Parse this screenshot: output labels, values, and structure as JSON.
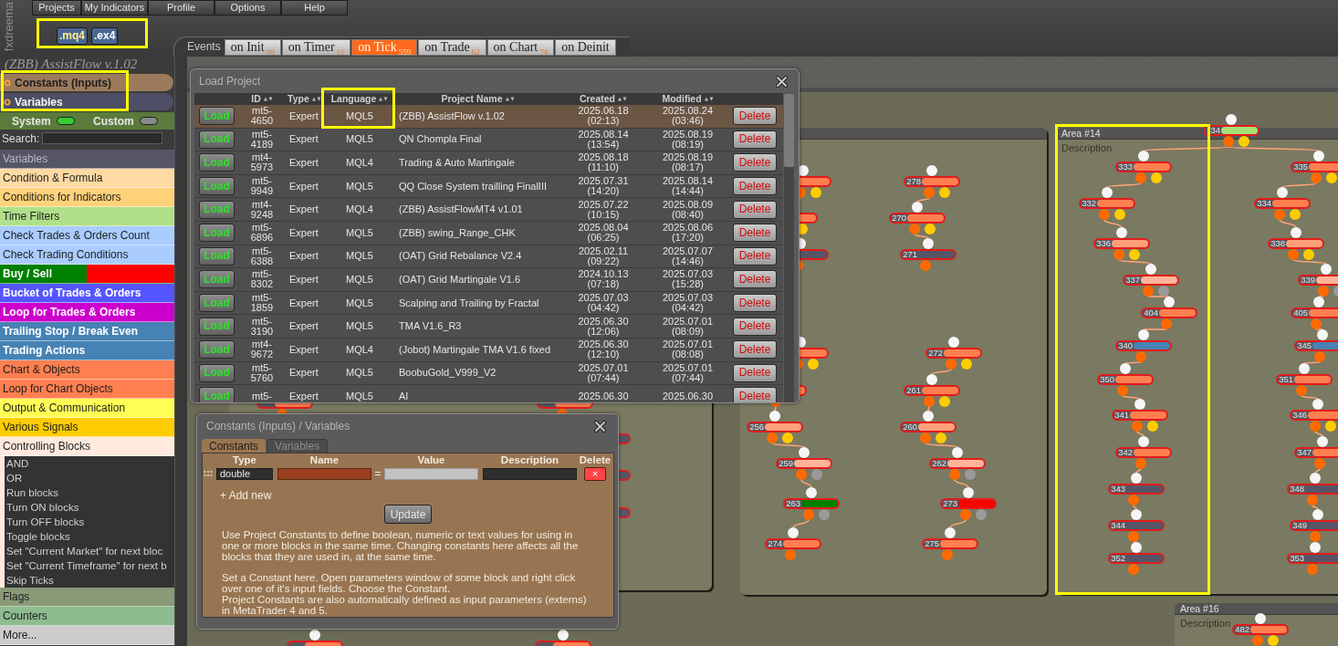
{
  "logo": "fxdreema",
  "menu": [
    "Projects",
    "My Indicators",
    "Profile",
    "Options",
    "Help"
  ],
  "export_buttons": {
    "highlighted": true,
    "items": [
      {
        "label": ".mq4",
        "selected": true
      },
      {
        "label": ".ex4",
        "selected": false
      }
    ]
  },
  "events": {
    "label": "Events",
    "tabs": [
      {
        "label": "on Init",
        "count": "88",
        "selected": false
      },
      {
        "label": "on Timer",
        "count": "11",
        "selected": false
      },
      {
        "label": "on Tick",
        "count": "559",
        "selected": true
      },
      {
        "label": "on Trade",
        "count": "62",
        "selected": false
      },
      {
        "label": "on Chart",
        "count": "74",
        "selected": false
      },
      {
        "label": "on Deinit",
        "selected": false
      }
    ]
  },
  "sidebar": {
    "project_title": "(ZBB) AssistFlow v.1.02",
    "highlighted": true,
    "sections": [
      {
        "label": "Constants (Inputs)",
        "color": "#9c7b5c"
      },
      {
        "label": "Variables",
        "color": "#4e4e66"
      }
    ],
    "toggles": [
      {
        "label": "System",
        "on": true
      },
      {
        "label": "Custom",
        "on": false
      }
    ],
    "search": {
      "label": "Search:"
    },
    "categories": [
      {
        "label": "Variables",
        "kind": "heading",
        "color": "#555566",
        "expanded": false
      },
      {
        "label": "Condition & Formula",
        "kind": "category",
        "color": "#ffd9a3",
        "expanded": false
      },
      {
        "label": "Conditions for Indicators",
        "kind": "category",
        "color": "#ffd27a",
        "expanded": false
      },
      {
        "label": "Time Filters",
        "kind": "category",
        "color": "#b0e08a",
        "expanded": false
      },
      {
        "label": "Check Trades & Orders Count",
        "kind": "category",
        "color": "#aaccff",
        "expanded": false
      },
      {
        "label": "Check Trading Conditions",
        "kind": "category",
        "color": "#aaccff",
        "expanded": false
      },
      {
        "label": "Buy / Sell",
        "kind": "category",
        "color": "#008000",
        "split": {
          "color": "#ff0000"
        },
        "expanded": false
      },
      {
        "label": "Bucket of Trades & Orders",
        "kind": "category",
        "color": "#5555ff",
        "expanded": false
      },
      {
        "label": "Loop for Trades & Orders",
        "kind": "category",
        "color": "#cc00cc",
        "expanded": false
      },
      {
        "label": "Trailing Stop / Break Even",
        "kind": "category",
        "color": "#4682b4",
        "expanded": false
      },
      {
        "label": "Trading Actions",
        "kind": "category",
        "color": "#4682b4",
        "expanded": false
      },
      {
        "label": "Chart & Objects",
        "kind": "category",
        "color": "#ff7f50",
        "expanded": false
      },
      {
        "label": "Loop for Chart Objects",
        "kind": "category",
        "color": "#ff7f50",
        "expanded": false
      },
      {
        "label": "Output & Communication",
        "kind": "category",
        "color": "#ffff55",
        "expanded": false
      },
      {
        "label": "Various Signals",
        "kind": "category",
        "color": "#ffcc00",
        "expanded": false
      },
      {
        "label": "Controlling Blocks",
        "kind": "category",
        "color": "#ffeadd",
        "expanded": true,
        "children": [
          "AND",
          "OR",
          "Run blocks",
          "Turn ON blocks",
          "Turn OFF blocks",
          "Toggle blocks",
          "Set \"Current Market\" for next bloc",
          "Set \"Current Timeframe\" for next b",
          "Skip Ticks"
        ]
      },
      {
        "label": "Flags",
        "kind": "category",
        "color": "#8a9a77",
        "expanded": false
      },
      {
        "label": "Counters",
        "kind": "category",
        "color": "#8fbc8f",
        "expanded": false
      },
      {
        "label": "More...",
        "kind": "category",
        "color": "#cccccc",
        "expanded": false
      }
    ]
  },
  "load_project": {
    "title": "Load Project",
    "columns": [
      {
        "label": "ID",
        "highlighted": false
      },
      {
        "label": "Type",
        "highlighted": false
      },
      {
        "label": "Language",
        "highlighted": true
      },
      {
        "label": "Project Name",
        "highlighted": false
      },
      {
        "label": "Created",
        "highlighted": false
      },
      {
        "label": "Modified",
        "highlighted": false
      }
    ],
    "rows": [
      {
        "load": "Load",
        "id": "mt5-4650",
        "type": "Expert",
        "language": "MQL5",
        "name": "(ZBB) AssistFlow v.1.02",
        "created": "2025.06.18 (02:13)",
        "modified": "2025.08.24 (03:46)",
        "delete": "Delete",
        "selected": true
      },
      {
        "load": "Load",
        "id": "mt5-4189",
        "type": "Expert",
        "language": "MQL5",
        "name": "QN Chompla Final",
        "created": "2025.08.14 (13:54)",
        "modified": "2025.08.19 (08:19)",
        "delete": "Delete",
        "selected": false
      },
      {
        "load": "Load",
        "id": "mt4-5973",
        "type": "Expert",
        "language": "MQL4",
        "name": "Trading & Auto Martingale",
        "created": "2025.08.18 (11:10)",
        "modified": "2025.08.19 (08:17)",
        "delete": "Delete",
        "selected": false
      },
      {
        "load": "Load",
        "id": "mt5-9949",
        "type": "Expert",
        "language": "MQL5",
        "name": "QQ Close System trailling FinalIII",
        "created": "2025.07.31 (14:20)",
        "modified": "2025.08.14 (14:44)",
        "delete": "Delete",
        "selected": false
      },
      {
        "load": "Load",
        "id": "mt4-9248",
        "type": "Expert",
        "language": "MQL4",
        "name": "(ZBB) AssistFlowMT4 v1.01",
        "created": "2025.07.22 (10:15)",
        "modified": "2025.08.09 (08:40)",
        "delete": "Delete",
        "selected": false
      },
      {
        "load": "Load",
        "id": "mt5-6896",
        "type": "Expert",
        "language": "MQL5",
        "name": "(ZBB) swing_Range_CHK",
        "created": "2025.08.04 (06:25)",
        "modified": "2025.08.06 (17:20)",
        "delete": "Delete",
        "selected": false
      },
      {
        "load": "Load",
        "id": "mt5-6388",
        "type": "Expert",
        "language": "MQL5",
        "name": "(OAT) Grid Rebalance V2.4",
        "created": "2025.02.11 (09:22)",
        "modified": "2025.07.07 (14:46)",
        "delete": "Delete",
        "selected": false
      },
      {
        "load": "Load",
        "id": "mt5-8302",
        "type": "Expert",
        "language": "MQL5",
        "name": "(OAT) Grid Martingale V1.6",
        "created": "2024.10.13 (07:18)",
        "modified": "2025.07.03 (15:28)",
        "delete": "Delete",
        "selected": false
      },
      {
        "load": "Load",
        "id": "mt5-1859",
        "type": "Expert",
        "language": "MQL5",
        "name": "Scalping and Trailing by Fractal",
        "created": "2025.07.03 (04:42)",
        "modified": "2025.07.03 (04:42)",
        "delete": "Delete",
        "selected": false
      },
      {
        "load": "Load",
        "id": "mt5-3190",
        "type": "Expert",
        "language": "MQL5",
        "name": "TMA V1.6_R3",
        "created": "2025.06.30 (12:06)",
        "modified": "2025.07.01 (08:09)",
        "delete": "Delete",
        "selected": false
      },
      {
        "load": "Load",
        "id": "mt4-9672",
        "type": "Expert",
        "language": "MQL4",
        "name": "(Jobot) Martingale TMA V1.6 fixed",
        "created": "2025.06.30 (12:10)",
        "modified": "2025.07.01 (08:08)",
        "delete": "Delete",
        "selected": false
      },
      {
        "load": "Load",
        "id": "mt5-5760",
        "type": "Expert",
        "language": "MQL5",
        "name": "BoobuGold_V999_V2",
        "created": "2025.07.01 (07:44)",
        "modified": "2025.07.01 (07:44)",
        "delete": "Delete",
        "selected": false
      },
      {
        "load": "Load",
        "id": "mt5-",
        "type": "Expert",
        "language": "MQL5",
        "name": "AI",
        "created": "2025.06.30",
        "modified": "2025.06.30",
        "delete": "Delete",
        "selected": false
      }
    ]
  },
  "constants_dialog": {
    "title": "Constants (Inputs) / Variables",
    "tabs": [
      {
        "label": "Constants",
        "selected": true
      },
      {
        "label": "Variables",
        "selected": false
      }
    ],
    "columns": [
      "Type",
      "Name",
      "Value",
      "Description",
      "Delete"
    ],
    "rows": [
      {
        "type": "double",
        "equals": "=",
        "delete": "×"
      }
    ],
    "add_new": "+ Add new",
    "update": "Update",
    "help": [
      "Use Project Constants to define boolean, numeric or text values for using in one or more blocks in the same time. Changing constants here affects all the blocks that they are used in, at the same time.",
      "Set a Constant here. Open parameters window of some block and right click over one of it's input fields. Choose the Constant.",
      "Project Constants are also automatically defined as input parameters (externs) in MetaTrader 4 and 5."
    ]
  },
  "canvas": {
    "areas": [
      {
        "highlighted": false,
        "nodes": [
          {
            "color": "#ff7f50"
          },
          {
            "color": "#ff7f50"
          },
          {
            "color": "#555566"
          },
          {
            "color": "#555566"
          },
          {
            "color": "#555566"
          },
          {
            "color": "#ff7f50"
          },
          {
            "color": "#ff7f50"
          }
        ]
      },
      {
        "highlighted": false,
        "nodes": [
          {
            "color": "#ff7f50",
            "port": {
              "color": "#ffcc00"
            }
          },
          {
            "color": "#ff7f50",
            "port": {
              "color": "#ffcc00"
            }
          },
          {
            "color": "#555566"
          },
          {
            "color": "#ff7f50",
            "port": {
              "color": "#ffcc00"
            }
          },
          {
            "color": "#ff7f50"
          },
          {
            "number": "256",
            "color": "#ffa07a",
            "port": {
              "color": "#ffcc00"
            }
          },
          {
            "number": "259",
            "color": "#ffb49a",
            "port": {
              "color": "#9a9a9a"
            }
          },
          {
            "number": "263",
            "color": "#008000",
            "port": {
              "color": "#9a9a9a"
            }
          },
          {
            "number": "274",
            "color": "#ff7f50"
          },
          {
            "number": "278",
            "color": "#ff7f50",
            "port": {
              "color": "#ffcc00"
            }
          },
          {
            "number": "270",
            "color": "#ff7f50",
            "port": {
              "color": "#ffcc00"
            }
          },
          {
            "number": "271",
            "color": "#555566"
          },
          {
            "number": "272",
            "color": "#ff7f50",
            "port": {
              "color": "#ffcc00"
            }
          },
          {
            "number": "261",
            "color": "#ff7f50",
            "port": {
              "color": "#ffcc00"
            }
          },
          {
            "number": "260",
            "color": "#ffa07a",
            "port": {
              "color": "#ffcc00"
            }
          },
          {
            "number": "262",
            "color": "#ffb49a",
            "port": {
              "color": "#9a9a9a"
            }
          },
          {
            "number": "273",
            "color": "#ff0000",
            "port": {
              "color": "#9a9a9a"
            }
          },
          {
            "number": "275",
            "color": "#ff7f50"
          }
        ]
      },
      {
        "title": "Area #14",
        "description": "Description",
        "highlighted": true,
        "nodes": [
          {
            "number": "34",
            "color": "#a8e078",
            "port": {
              "color": "#ffcc00"
            }
          },
          {
            "number": "333",
            "color": "#ff7f50",
            "port": {
              "color": "#ffcc00"
            }
          },
          {
            "number": "332",
            "color": "#ff7f50",
            "port": {
              "color": "#ffcc00"
            }
          },
          {
            "number": "336",
            "color": "#ffa07a",
            "port": {
              "color": "#ffcc00"
            }
          },
          {
            "number": "337",
            "color": "#ffb49a",
            "port": {
              "color": "#9a9a9a"
            }
          },
          {
            "number": "404",
            "color": "#ff7f50"
          },
          {
            "number": "340",
            "color": "#4682b4"
          },
          {
            "number": "350",
            "color": "#ff7f50"
          },
          {
            "number": "341",
            "color": "#ff7f50",
            "port": {
              "color": "#ffcc00"
            }
          },
          {
            "number": "342",
            "color": "#ff7f50"
          },
          {
            "number": "343",
            "color": "#555566"
          },
          {
            "number": "344",
            "color": "#555566"
          },
          {
            "number": "352",
            "color": "#555566"
          },
          {
            "number": "335",
            "color": "#ff7f50",
            "port": {
              "color": "#ffcc00"
            }
          },
          {
            "number": "334",
            "color": "#ff7f50",
            "port": {
              "color": "#ffcc00"
            }
          },
          {
            "number": "338",
            "color": "#ffa07a",
            "port": {
              "color": "#ffcc00"
            }
          },
          {
            "number": "339",
            "color": "#ffb49a",
            "port": {
              "color": "#9a9a9a"
            }
          },
          {
            "number": "405",
            "color": "#ff7f50"
          },
          {
            "number": "345",
            "color": "#4682b4"
          },
          {
            "number": "351",
            "color": "#ff7f50"
          },
          {
            "number": "346",
            "color": "#ff7f50",
            "port": {
              "color": "#ffcc00"
            }
          },
          {
            "number": "347",
            "color": "#ff7f50"
          },
          {
            "number": "348",
            "color": "#555566"
          },
          {
            "number": "349",
            "color": "#555566"
          },
          {
            "number": "353",
            "color": "#555566"
          }
        ]
      },
      {
        "title": "Area #16",
        "description": "Description",
        "highlighted": false,
        "nodes": [
          {
            "number": "482",
            "color": "#ff7f50",
            "port": {
              "color": "#ffcc00"
            }
          }
        ]
      }
    ]
  }
}
